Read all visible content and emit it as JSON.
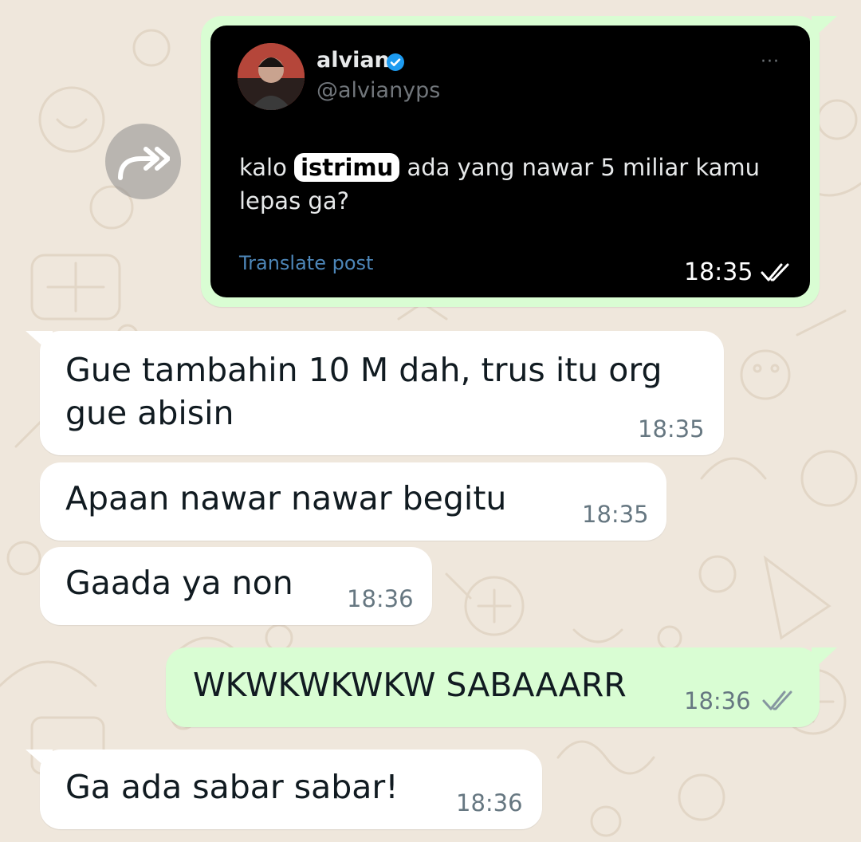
{
  "post": {
    "author_name": "alvian",
    "author_handle": "@alvianyps",
    "text_before": "kalo",
    "text_highlight": "istrimu",
    "text_after_line1": "ada yang nawar 5 miliar kamu",
    "text_line2": "lepas ga?",
    "translate_label": "Translate post",
    "more_label": "···",
    "time": "18:35"
  },
  "messages": [
    {
      "direction": "in",
      "line1": "Gue tambahin 10 M dah, trus itu org",
      "line2": "gue abisin",
      "time": "18:35"
    },
    {
      "direction": "in",
      "text": "Apaan nawar nawar begitu",
      "time": "18:35"
    },
    {
      "direction": "in",
      "text": "Gaada ya non",
      "time": "18:36"
    },
    {
      "direction": "out",
      "text": "WKWKWKWKW SABAAARR",
      "time": "18:36",
      "status": "read"
    },
    {
      "direction": "in",
      "text": "Ga ada sabar sabar!",
      "time": "18:36"
    }
  ],
  "icons": {
    "forward": "forward-icon",
    "read_ticks": "double-check-icon",
    "verified": "verified-badge-icon"
  },
  "colors": {
    "wallpaper": "#efe7dc",
    "incoming_bubble": "#ffffff",
    "outgoing_bubble": "#d9fdd3",
    "verified_blue": "#1d9bf0",
    "link_blue": "#4d86b8"
  }
}
